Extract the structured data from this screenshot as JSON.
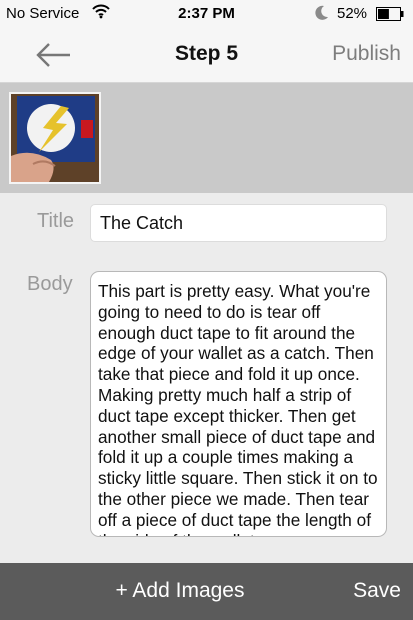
{
  "status_bar": {
    "carrier": "No Service",
    "time": "2:37 PM",
    "battery": "52%",
    "battery_level": 0.52,
    "icons": [
      "wifi-icon",
      "moon-icon",
      "battery-icon"
    ]
  },
  "nav": {
    "back_icon": "left-arrow-icon",
    "title": "Step 5",
    "publish_label": "Publish"
  },
  "images": {
    "thumbnails": [
      {
        "description_icon": "flash-logo-wallet-photo"
      }
    ]
  },
  "form": {
    "title_label": "Title",
    "title_value": "The Catch",
    "body_label": "Body",
    "body_value": "This part is pretty easy. What you're going to need to do is tear off enough duct tape to fit around the edge of your wallet as a catch. Then take that piece and fold it up once. Making pretty much half a strip of duct tape except thicker. Then get another small piece of duct tape and fold it up a couple times making a sticky little square. Then stick it on to the other piece we made. Then tear off a piece of duct tape the length of the side of the wallet."
  },
  "bottom_bar": {
    "add_images_label": "+ Add Images",
    "save_label": "Save"
  },
  "colors": {
    "bar_background": "#f6f6f6",
    "image_strip": "#c9c9c9",
    "form_background": "#ececec",
    "bottom_bar": "#5b5b5b",
    "label_gray": "#9a9a9a",
    "publish_gray": "#7d7d7d"
  }
}
